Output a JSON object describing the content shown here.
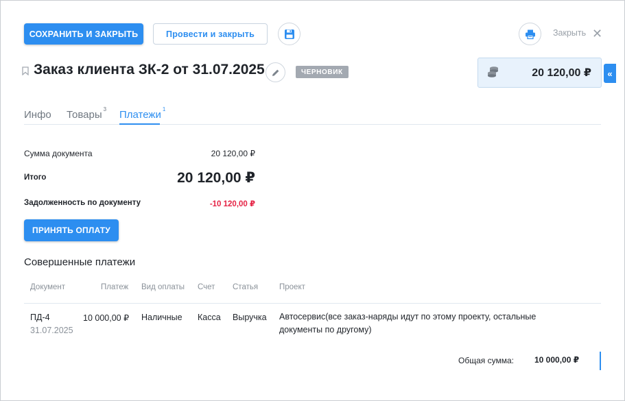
{
  "toolbar": {
    "save_close_label": "Сохранить и закрыть",
    "post_close_label": "Провести и закрыть",
    "close_label": "Закрыть"
  },
  "document": {
    "title": "Заказ клиента ЗК-2 от 31.07.2025",
    "status": "Черновик",
    "total_amount": "20 120,00 ₽"
  },
  "tabs": [
    {
      "label": "Инфо",
      "badge": ""
    },
    {
      "label": "Товары",
      "badge": "3"
    },
    {
      "label": "Платежи",
      "badge": "1"
    }
  ],
  "summary": {
    "doc_sum_label": "Сумма документа",
    "doc_sum_value": "20 120,00 ₽",
    "total_label": "Итого",
    "total_value": "20 120,00 ₽",
    "debt_label": "Задолженность по документу",
    "debt_value": "-10 120,00 ₽"
  },
  "accept_payment_label": "Принять оплату",
  "payments": {
    "title": "Совершенные платежи",
    "columns": [
      "Документ",
      "Платеж",
      "Вид оплаты",
      "Счет",
      "Статья",
      "Проект"
    ],
    "rows": [
      {
        "doc": "ПД-4",
        "date": "31.07.2025",
        "amount": "10 000,00 ₽",
        "method": "Наличные",
        "account": "Касса",
        "article": "Выручка",
        "project": "Автосервис(все заказ-наряды идут по этому проекту, остальные документы по другому)"
      }
    ],
    "total_label": "Общая сумма:",
    "total_value": "10 000,00 ₽"
  },
  "colors": {
    "accent": "#2d8ef0",
    "debt": "#e52345",
    "badge": "#a3a9b1"
  }
}
